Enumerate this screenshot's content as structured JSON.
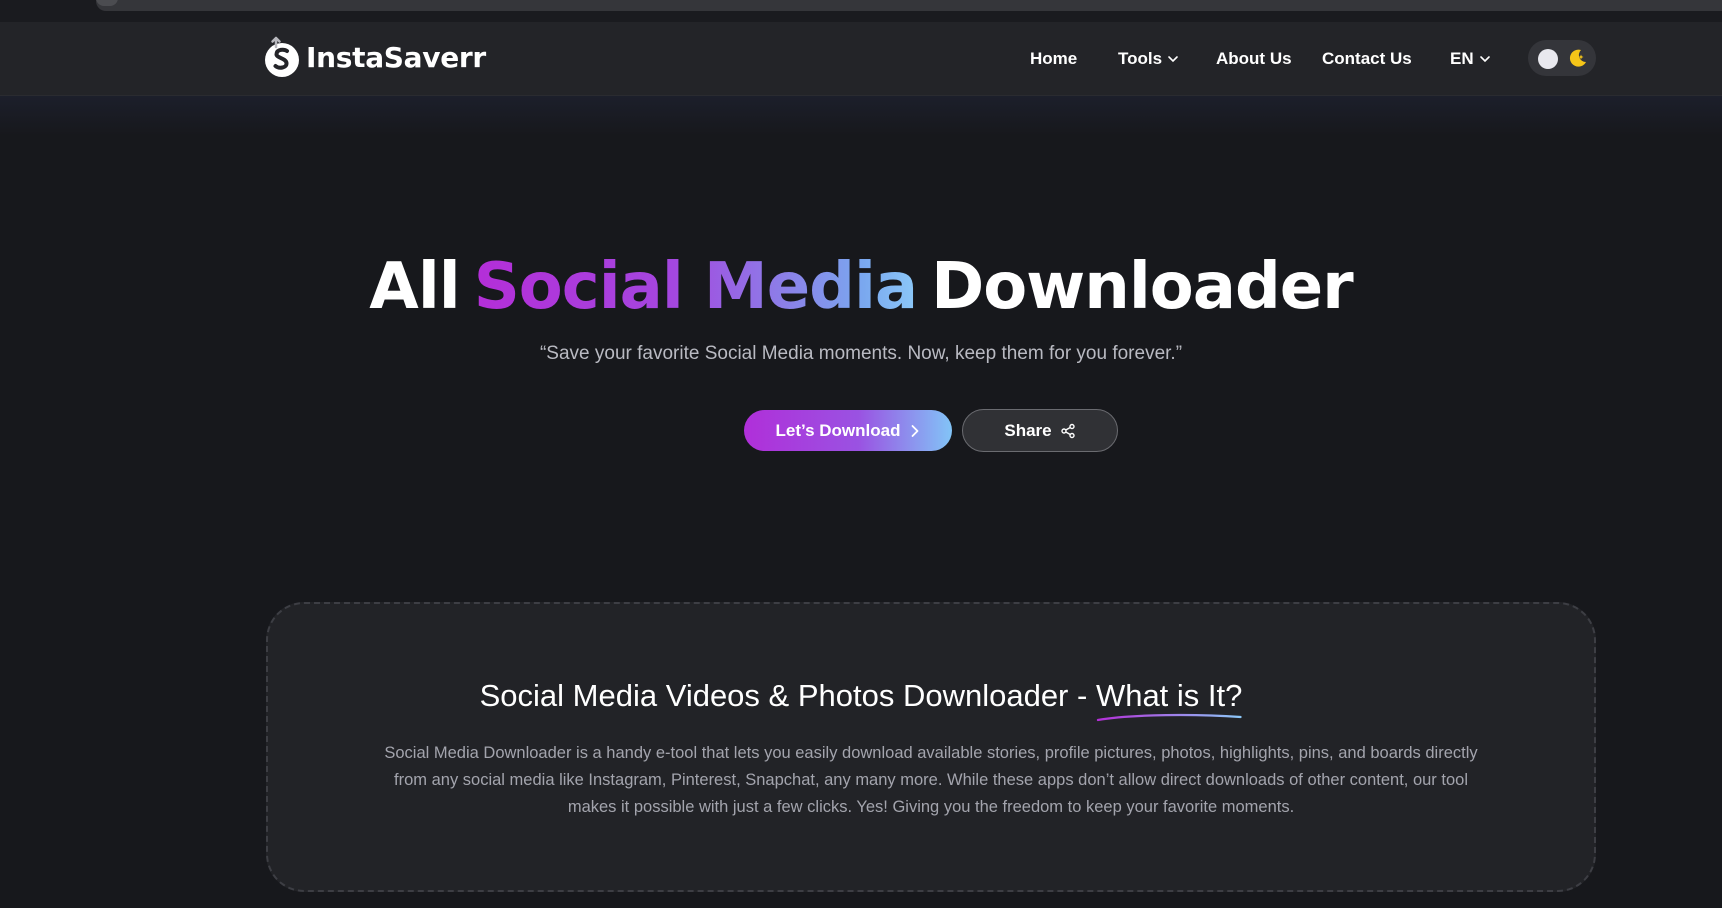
{
  "header": {
    "brand": "InstaSaverr",
    "nav": {
      "home": "Home",
      "tools": "Tools",
      "about": "About Us",
      "contact": "Contact Us",
      "language": "EN"
    }
  },
  "hero": {
    "title_start": "All",
    "title_highlight": "Social Media",
    "title_end": "Downloader",
    "subtitle": "“Save your favorite Social Media moments. Now, keep them for you forever.”",
    "download_button": "Let’s Download",
    "share_button": "Share"
  },
  "info": {
    "title_start": "Social Media Videos & Photos Downloader - ",
    "title_highlight": "What is It?",
    "body": "Social Media Downloader is a handy e-tool that lets you easily download available stories, profile pictures, photos, highlights, pins, and boards directly from any social media like Instagram, Pinterest, Snapchat, any many more. While these apps don’t allow direct downloads of other content, our tool makes it possible with just a few clicks. Yes! Giving you the freedom to keep your favorite moments."
  },
  "theme": {
    "mode": "dark",
    "accent_start": "#b42ed8",
    "accent_end": "#8cc8f8",
    "moon_color": "#f5c518"
  },
  "icons": [
    "logo-icon",
    "chevron-down-icon",
    "moon-icon",
    "chevron-right-icon",
    "share-icon"
  ]
}
